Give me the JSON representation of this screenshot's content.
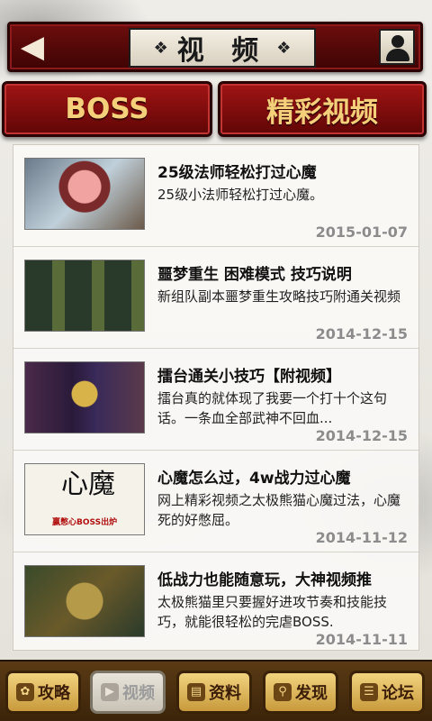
{
  "header": {
    "back_icon": "back-arrow-icon",
    "title": "视 频",
    "user_icon": "user-icon"
  },
  "tabs": [
    {
      "label": "BOSS",
      "active": true
    },
    {
      "label": "精彩视频",
      "active": false
    }
  ],
  "videos": [
    {
      "title": "25级法师轻松打过心魔",
      "desc": "25级小法师轻松打过心魔。",
      "date": "2015-01-07"
    },
    {
      "title": "噩梦重生 困难模式 技巧说明",
      "desc": "新组队副本噩梦重生攻略技巧附通关视频",
      "date": "2014-12-15"
    },
    {
      "title": "擂台通关小技巧【附视频】",
      "desc": "擂台真的就体现了我要一个打十个这句话。一条血全部武神不回血...",
      "date": "2014-12-15"
    },
    {
      "title": "心魔怎么过，4w战力过心魔",
      "desc": "网上精彩视频之太极熊猫心魔过法，心魔死的好憋屈。",
      "date": "2014-11-12",
      "thumb_calligraphy": "心魔",
      "thumb_caption": "赢憋心BOSS出炉"
    },
    {
      "title": "低战力也能随意玩，大神视频推",
      "desc": "太极熊猫里只要握好进攻节奏和技能技巧，就能很轻松的完虐BOSS.",
      "date": "2014-11-11"
    }
  ],
  "bottom_nav": [
    {
      "label": "攻略",
      "icon": "paw-icon",
      "active": false
    },
    {
      "label": "视频",
      "icon": "video-icon",
      "active": true
    },
    {
      "label": "资料",
      "icon": "book-icon",
      "active": false
    },
    {
      "label": "发现",
      "icon": "search-icon",
      "active": false
    },
    {
      "label": "论坛",
      "icon": "forum-icon",
      "active": false
    }
  ],
  "colors": {
    "header_red": "#6d0d0d",
    "tab_gold": "#f4d07a",
    "nav_gold": "#f1d37f",
    "date_gray": "#8c8c8c"
  }
}
